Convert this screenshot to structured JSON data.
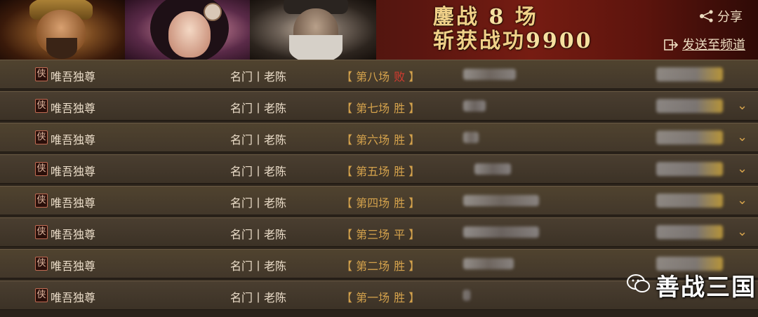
{
  "header": {
    "battle_label": "鏖战",
    "battle_count": "8",
    "battle_unit": "场",
    "merit_label": "斩获战功",
    "merit_value": "9900",
    "share_label": "分享",
    "send_label": "发送至频道"
  },
  "rows": [
    {
      "badge": "侠",
      "name": "唯吾独尊",
      "opponent": "名门丨老陈",
      "fight": "第八场",
      "result": "败",
      "outcome": "lose"
    },
    {
      "badge": "侠",
      "name": "唯吾独尊",
      "opponent": "名门丨老陈",
      "fight": "第七场",
      "result": "胜",
      "outcome": "win"
    },
    {
      "badge": "侠",
      "name": "唯吾独尊",
      "opponent": "名门丨老陈",
      "fight": "第六场",
      "result": "胜",
      "outcome": "win"
    },
    {
      "badge": "侠",
      "name": "唯吾独尊",
      "opponent": "名门丨老陈",
      "fight": "第五场",
      "result": "胜",
      "outcome": "win"
    },
    {
      "badge": "侠",
      "name": "唯吾独尊",
      "opponent": "名门丨老陈",
      "fight": "第四场",
      "result": "胜",
      "outcome": "win"
    },
    {
      "badge": "侠",
      "name": "唯吾独尊",
      "opponent": "名门丨老陈",
      "fight": "第三场",
      "result": "平",
      "outcome": "draw"
    },
    {
      "badge": "侠",
      "name": "唯吾独尊",
      "opponent": "名门丨老陈",
      "fight": "第二场",
      "result": "胜",
      "outcome": "win"
    },
    {
      "badge": "侠",
      "name": "唯吾独尊",
      "opponent": "名门丨老陈",
      "fight": "第一场",
      "result": "胜",
      "outcome": "win"
    }
  ],
  "watermark": "善战三国",
  "colors": {
    "gold": "#d4a24c",
    "lose_red": "#d63b30",
    "text": "#eadcc8"
  }
}
